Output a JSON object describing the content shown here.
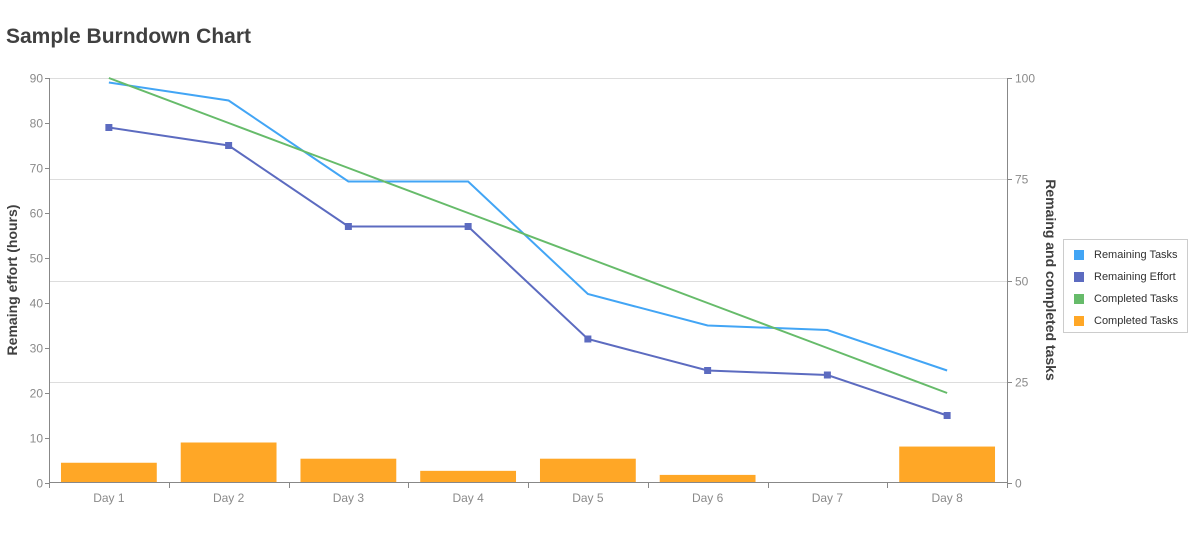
{
  "chart_data": {
    "type": "line",
    "title": "Sample Burndown Chart",
    "categories": [
      "Day 1",
      "Day 2",
      "Day 3",
      "Day 4",
      "Day 5",
      "Day 6",
      "Day 7",
      "Day 8"
    ],
    "xlabel": "",
    "ylabel_left": "Remaing effort (hours)",
    "ylabel_right": "Remaing and completed tasks",
    "ylim_left": [
      0,
      90
    ],
    "yticks_left": [
      0,
      10,
      20,
      30,
      40,
      50,
      60,
      70,
      80,
      90
    ],
    "ylim_right": [
      0,
      100
    ],
    "yticks_right": [
      0,
      25,
      50,
      75,
      100
    ],
    "grid": "horizontal, aligned to right axis",
    "legend_position": "right",
    "series": [
      {
        "name": "Remaining Tasks",
        "type": "line",
        "axis": "left",
        "color": "#42a5f5",
        "markers": false,
        "values": [
          89,
          85,
          67,
          67,
          42,
          35,
          34,
          25
        ]
      },
      {
        "name": "Remaining Effort",
        "type": "line",
        "axis": "left",
        "color": "#5c6bc0",
        "markers": true,
        "values": [
          79,
          75,
          57,
          57,
          32,
          25,
          24,
          15
        ]
      },
      {
        "name": "Completed Tasks",
        "type": "line",
        "axis": "left",
        "color": "#66bb6a",
        "markers": false,
        "values": [
          90,
          80,
          70,
          60,
          50,
          40,
          30,
          20
        ]
      },
      {
        "name": "Completed Tasks",
        "type": "bar",
        "axis": "right",
        "color": "#ffa726",
        "values": [
          5,
          10,
          6,
          3,
          6,
          2,
          0,
          9
        ]
      }
    ]
  },
  "legend": [
    {
      "label": "Remaining Tasks",
      "color": "#42a5f5"
    },
    {
      "label": "Remaining Effort",
      "color": "#5c6bc0"
    },
    {
      "label": "Completed Tasks",
      "color": "#66bb6a"
    },
    {
      "label": "Completed Tasks",
      "color": "#ffa726"
    }
  ]
}
